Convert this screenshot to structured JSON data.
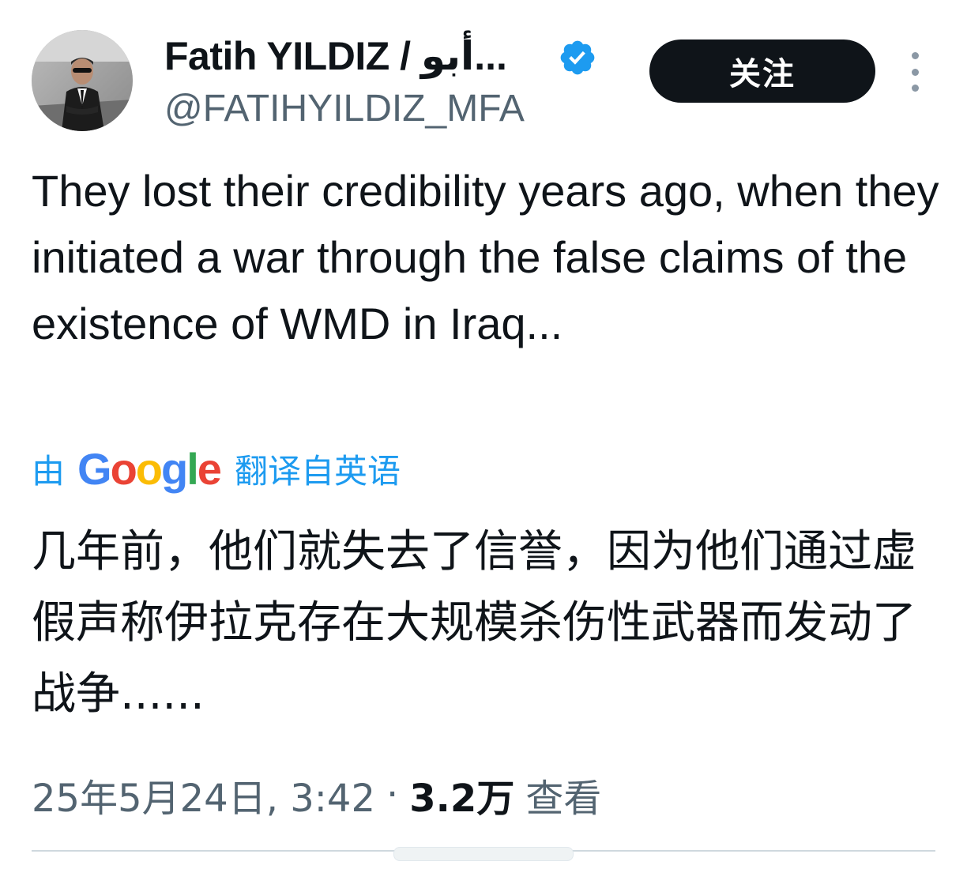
{
  "author": {
    "display_name": "Fatih YILDIZ / أبو...",
    "handle": "@FATIHYILDIZ_MFA",
    "verified": true,
    "verified_color": "#1d9bf0"
  },
  "actions": {
    "follow_label": "关注",
    "more_icon": "more-vertical-icon"
  },
  "tweet": {
    "text": "They lost their credibility years ago, when they initiated a war through the false claims of the existence of WMD in Iraq..."
  },
  "translation": {
    "prefix": "由",
    "provider": "Google",
    "suffix": "翻译自英语",
    "text": "几年前，他们就失去了信誉，因为他们通过虚假声称伊拉克存在大规模杀伤性武器而发动了战争......"
  },
  "meta": {
    "timestamp": "25年5月24日, 3:42",
    "separator": "·",
    "views_count": "3.2万",
    "views_label": "查看"
  },
  "colors": {
    "text_primary": "#0f1419",
    "text_secondary": "#536471",
    "link_blue": "#1d9bf0"
  }
}
